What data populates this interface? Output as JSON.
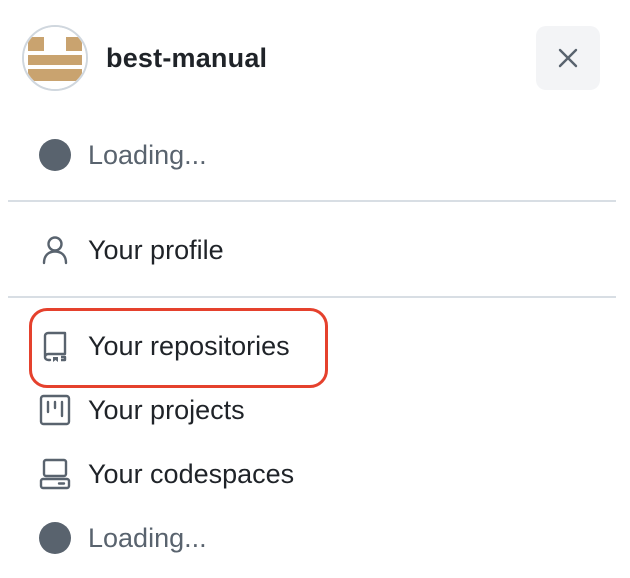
{
  "header": {
    "username": "best-manual",
    "close_icon": "x-icon"
  },
  "menu": {
    "loading_top": {
      "label": "Loading...",
      "icon": "status-dot-icon"
    },
    "profile": {
      "label": "Your profile",
      "icon": "person-icon"
    },
    "repositories": {
      "label": "Your repositories",
      "icon": "repo-icon",
      "highlighted": true,
      "highlight_color": "#e5412d"
    },
    "projects": {
      "label": "Your projects",
      "icon": "project-icon"
    },
    "codespaces": {
      "label": "Your codespaces",
      "icon": "codespaces-icon"
    },
    "loading_bottom": {
      "label": "Loading...",
      "icon": "status-dot-icon"
    }
  }
}
